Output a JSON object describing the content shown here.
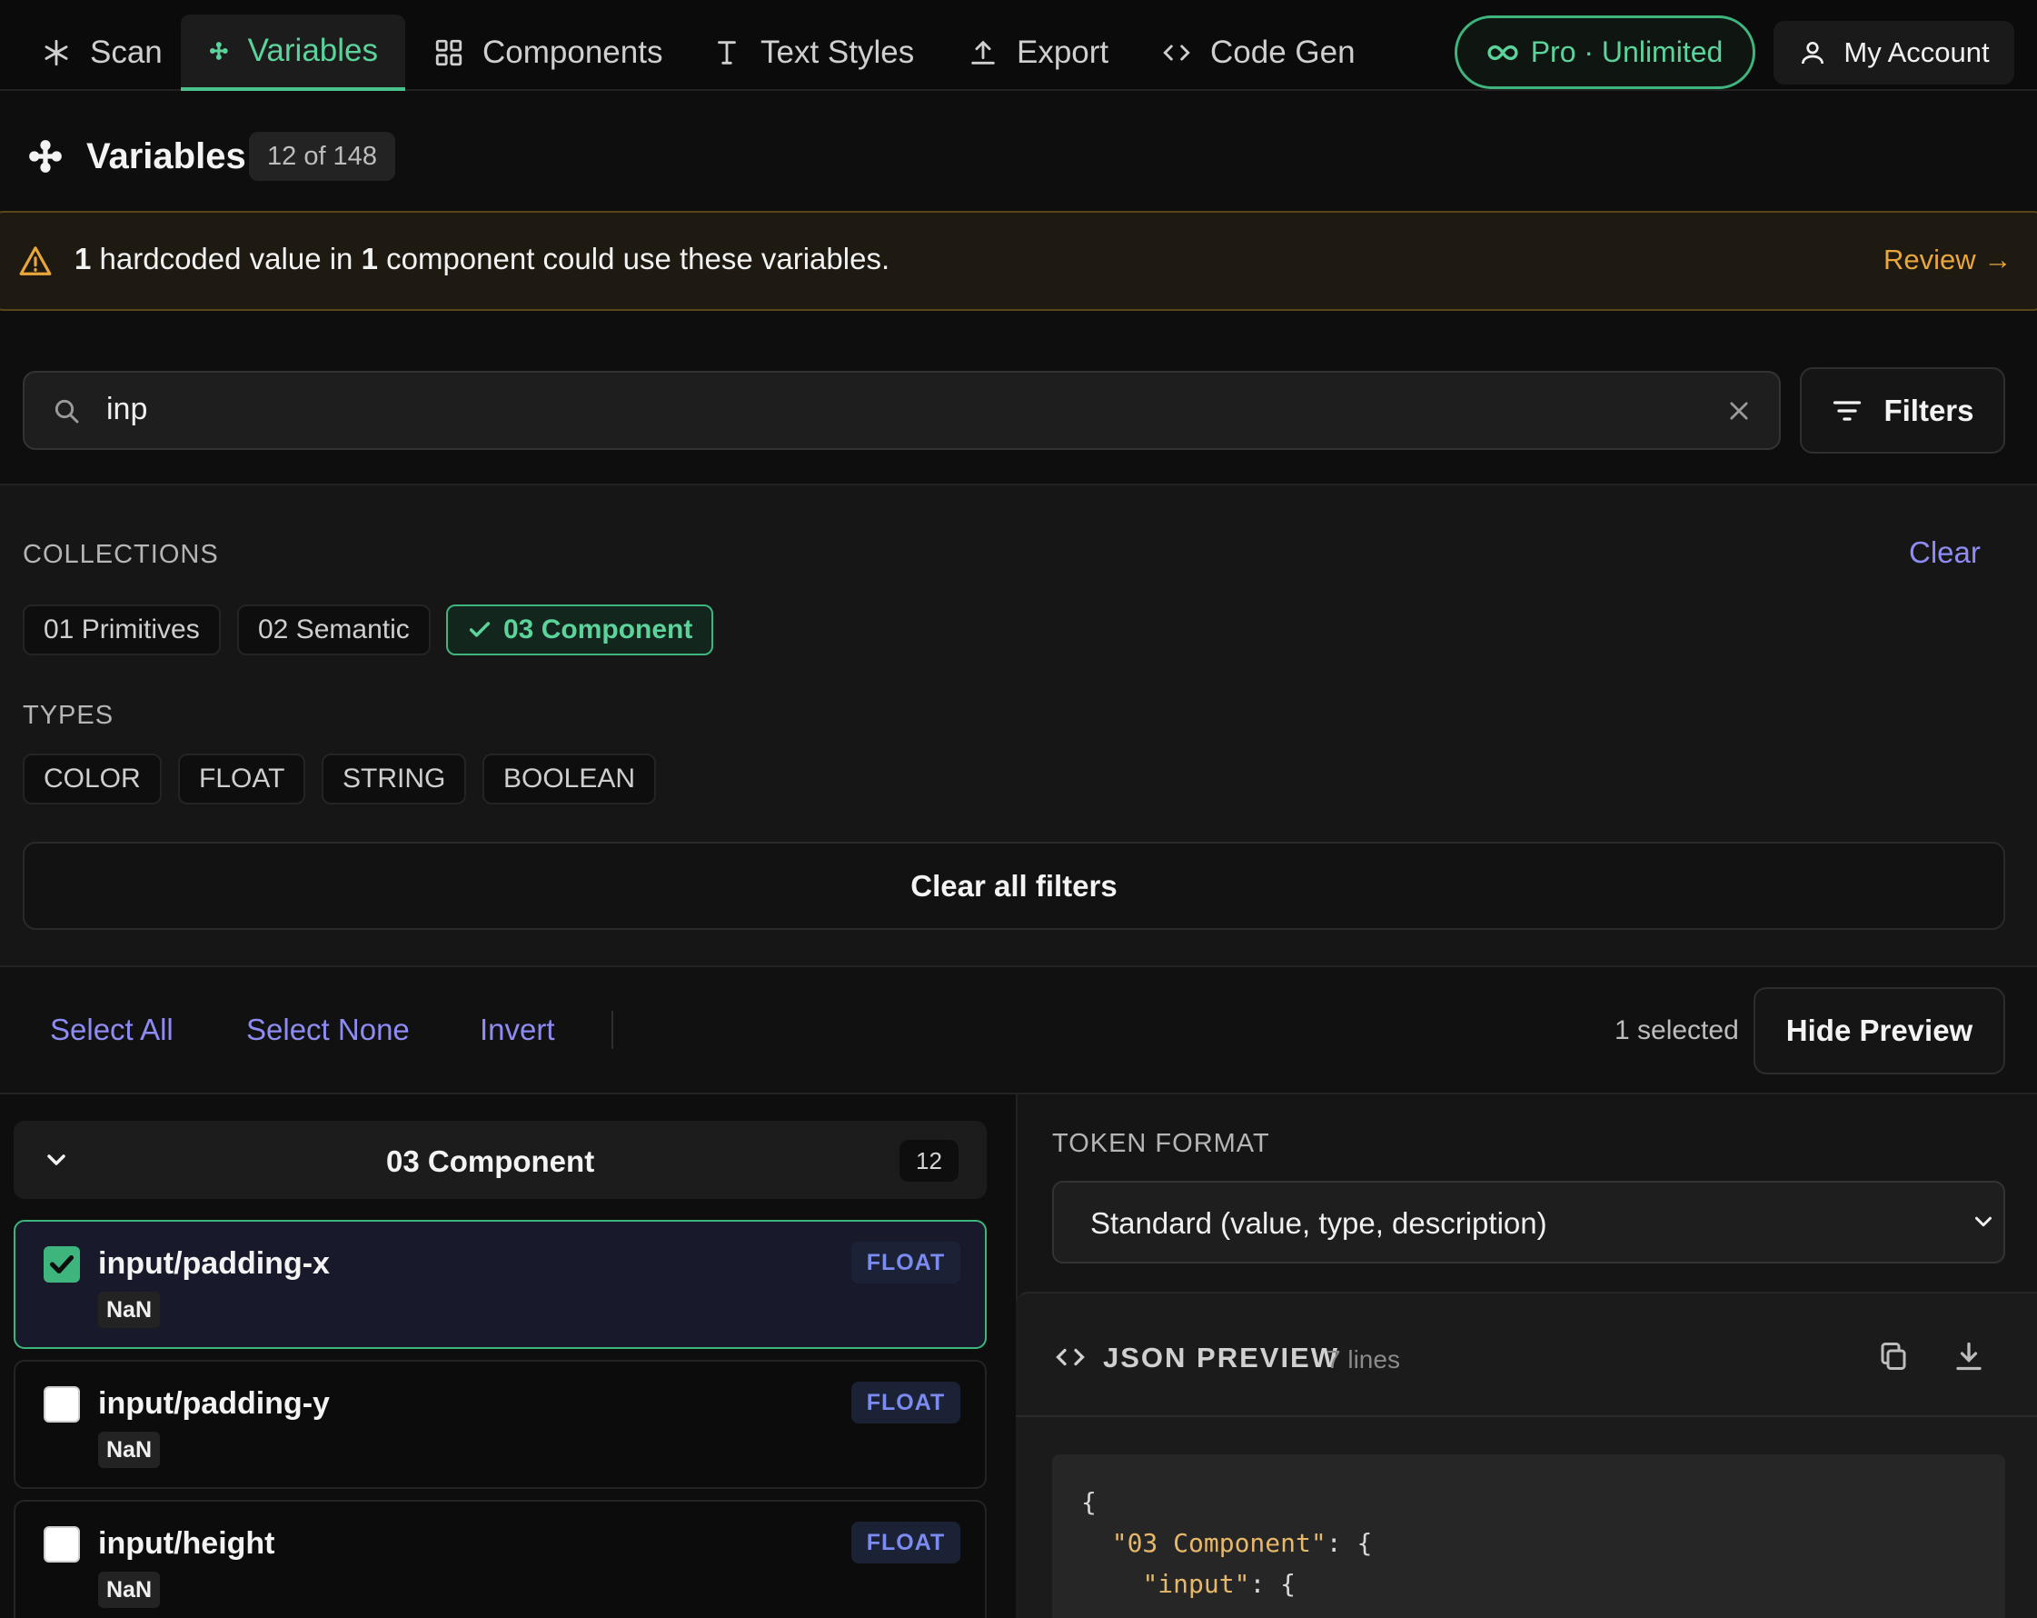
{
  "nav": {
    "tabs": [
      {
        "label": "Scan",
        "icon": "asterisk-icon"
      },
      {
        "label": "Variables",
        "icon": "variables-icon",
        "active": true
      },
      {
        "label": "Components",
        "icon": "grid-icon"
      },
      {
        "label": "Text Styles",
        "icon": "text-cursor-icon"
      },
      {
        "label": "Export",
        "icon": "upload-icon"
      },
      {
        "label": "Code Gen",
        "icon": "code-icon"
      }
    ],
    "pro_label": "Pro · Unlimited",
    "account_label": "My Account"
  },
  "header": {
    "title": "Variables",
    "count": "12 of 148"
  },
  "warning": {
    "count_a": "1",
    "text_a": "hardcoded value in",
    "count_b": "1",
    "text_b": "component could use these variables.",
    "action": "Review →"
  },
  "search": {
    "value": "inp",
    "filters_label": "Filters"
  },
  "filters": {
    "collections_label": "COLLECTIONS",
    "clear_label": "Clear",
    "collections": [
      {
        "label": "01 Primitives",
        "selected": false
      },
      {
        "label": "02 Semantic",
        "selected": false
      },
      {
        "label": "03 Component",
        "selected": true
      }
    ],
    "types_label": "TYPES",
    "types": [
      "COLOR",
      "FLOAT",
      "STRING",
      "BOOLEAN"
    ],
    "clear_all_label": "Clear all filters"
  },
  "selection": {
    "select_all": "Select All",
    "select_none": "Select None",
    "invert": "Invert",
    "selected_count": "1 selected",
    "hide_preview": "Hide Preview"
  },
  "group": {
    "title": "03 Component",
    "count": "12"
  },
  "variables": [
    {
      "name": "input/padding-x",
      "value": "NaN",
      "type": "FLOAT",
      "checked": true
    },
    {
      "name": "input/padding-y",
      "value": "NaN",
      "type": "FLOAT",
      "checked": false
    },
    {
      "name": "input/height",
      "value": "NaN",
      "type": "FLOAT",
      "checked": false
    }
  ],
  "preview": {
    "token_format_label": "TOKEN FORMAT",
    "token_format_value": "Standard (value, type, description)",
    "json_title": "JSON PREVIEW",
    "json_lines": "7 lines",
    "code": {
      "line1": "{",
      "line2_key": "\"03 Component\"",
      "line2_rest": ": {",
      "line3_key": "\"input\"",
      "line3_rest": ": {"
    }
  },
  "colors": {
    "accent_green": "#3fb57e",
    "accent_purple": "#8e8cf2",
    "warning_orange": "#e9a63a"
  }
}
